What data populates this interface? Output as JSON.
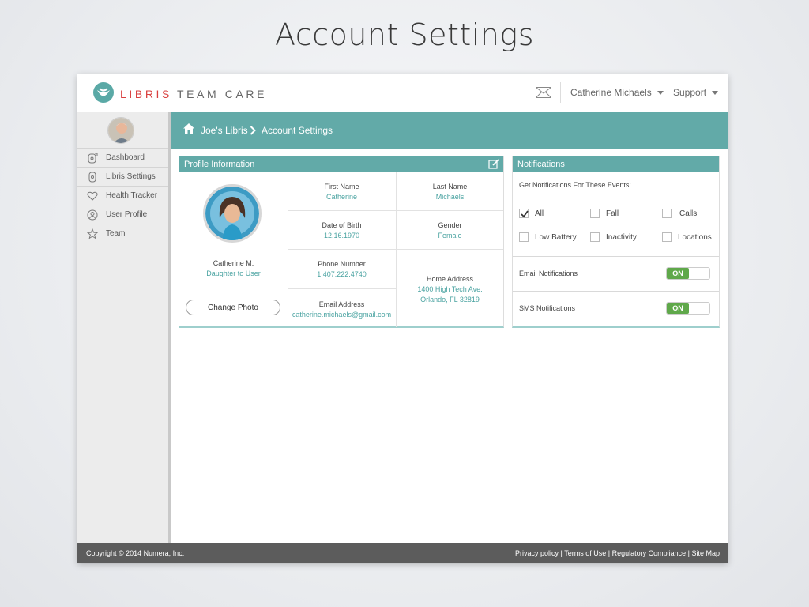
{
  "slide": {
    "title": "Account Settings"
  },
  "header": {
    "brand_first": "LIBRIS",
    "brand_second": "TEAM CARE",
    "user_name": "Catherine Michaels",
    "support_label": "Support"
  },
  "sidebar": {
    "items": [
      {
        "label": "Dashboard",
        "icon": "dashboard-icon"
      },
      {
        "label": "Libris Settings",
        "icon": "device-icon"
      },
      {
        "label": "Health Tracker",
        "icon": "heart-icon"
      },
      {
        "label": "User Profile",
        "icon": "profile-icon"
      },
      {
        "label": "Team",
        "icon": "star-icon"
      }
    ]
  },
  "breadcrumb": {
    "home": "Joe's Libris",
    "current": "Account Settings"
  },
  "profile": {
    "title": "Profile Information",
    "name": "Catherine M.",
    "relation": "Daughter to User",
    "change_photo": "Change Photo",
    "first_name_label": "First Name",
    "first_name": "Catherine",
    "last_name_label": "Last Name",
    "last_name": "Michaels",
    "dob_label": "Date of Birth",
    "dob": "12.16.1970",
    "gender_label": "Gender",
    "gender": "Female",
    "phone_label": "Phone Number",
    "phone": "1.407.222.4740",
    "email_label": "Email Address",
    "email": "catherine.michaels@gmail.com",
    "address_label": "Home Address",
    "address_line1": "1400 High Tech Ave.",
    "address_line2": "Orlando, FL 32819"
  },
  "notifications": {
    "title": "Notifications",
    "events_label": "Get Notifications For These Events:",
    "options": [
      {
        "label": "All",
        "checked": true
      },
      {
        "label": "Fall",
        "checked": false
      },
      {
        "label": "Calls",
        "checked": false
      },
      {
        "label": "Low Battery",
        "checked": false
      },
      {
        "label": "Inactivity",
        "checked": false
      },
      {
        "label": "Locations",
        "checked": false
      }
    ],
    "email_label": "Email Notifications",
    "email_state": "ON",
    "sms_label": "SMS Notifications",
    "sms_state": "ON"
  },
  "footer": {
    "copyright": "Copyright © 2014 Numera, Inc.",
    "links": [
      "Privacy policy",
      "Terms of Use",
      "Regulatory Compliance",
      "Site Map"
    ]
  },
  "colors": {
    "teal": "#62aaa8",
    "brand_red": "#d9403f",
    "toggle_green": "#5fa84a",
    "footer": "#5c5c5c"
  }
}
